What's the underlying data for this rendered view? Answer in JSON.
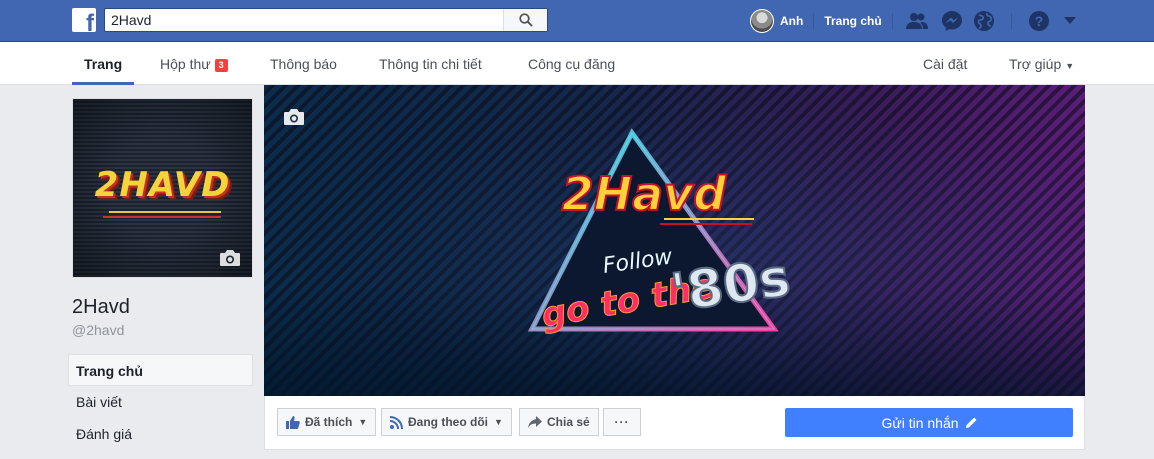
{
  "topbar": {
    "logo": "f",
    "search_value": "2Havd",
    "user_name": "Anh",
    "home_label": "Trang chủ",
    "icons": [
      "facebook-logo-icon",
      "search-icon",
      "avatar",
      "friend-requests-icon",
      "messenger-icon",
      "globe-icon",
      "help-icon",
      "chevron-down-icon"
    ]
  },
  "pagenav": {
    "tabs": [
      {
        "label": "Trang",
        "active": true
      },
      {
        "label": "Hộp thư",
        "badge": "3"
      },
      {
        "label": "Thông báo"
      },
      {
        "label": "Thông tin chi tiết"
      },
      {
        "label": "Công cụ đăng"
      }
    ],
    "settings_label": "Cài đặt",
    "help_label": "Trợ giúp"
  },
  "profile": {
    "logo_text": "2HAVD",
    "page_name": "2Havd",
    "handle": "@2havd"
  },
  "sidenav": {
    "items": [
      "Trang chủ",
      "Bài viết",
      "Đánh giá"
    ]
  },
  "cover": {
    "logo_text": "2Havd",
    "follow_text": "Follow",
    "go_to_text": "go to the",
    "eighties_text": "'80s"
  },
  "actions": {
    "liked_label": "Đã thích",
    "following_label": "Đang theo dõi",
    "share_label": "Chia sẻ",
    "more_label": "···",
    "send_message_label": "Gửi tin nhắn"
  },
  "colors": {
    "brand_blue": "#4267b2",
    "send_button": "#4080ff",
    "badge_red": "#fa3e3e"
  }
}
